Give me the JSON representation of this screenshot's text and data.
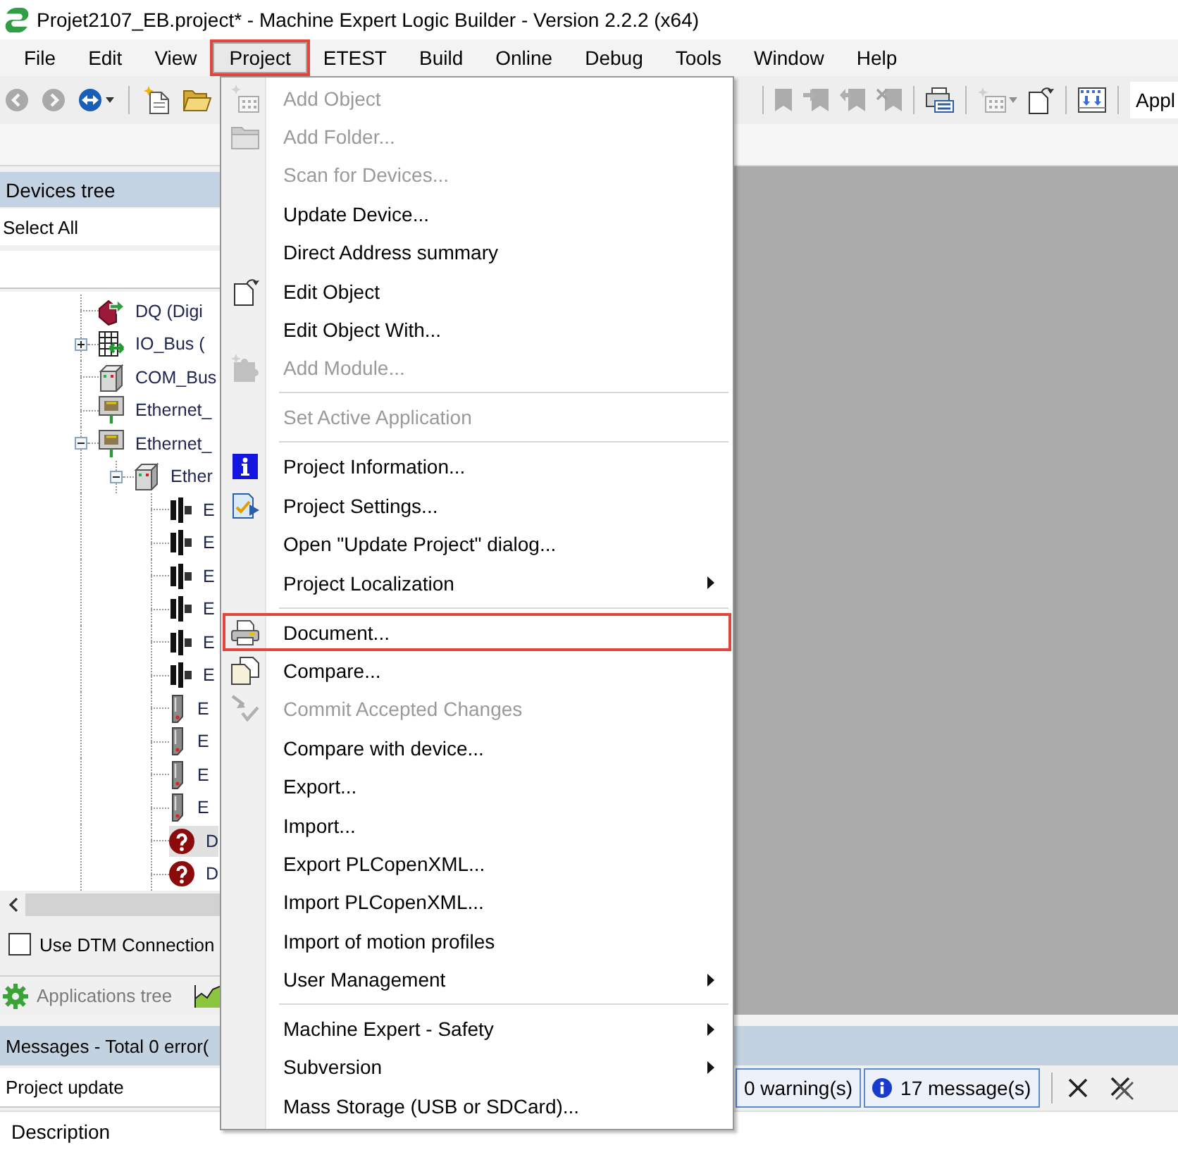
{
  "window": {
    "title": "Projet2107_EB.project* - Machine Expert Logic Builder - Version 2.2.2 (x64)"
  },
  "menu_bar": [
    {
      "label": "File",
      "selected": false
    },
    {
      "label": "Edit",
      "selected": false
    },
    {
      "label": "View",
      "selected": false
    },
    {
      "label": "Project",
      "selected": true
    },
    {
      "label": "ETEST",
      "selected": false
    },
    {
      "label": "Build",
      "selected": false
    },
    {
      "label": "Online",
      "selected": false
    },
    {
      "label": "Debug",
      "selected": false
    },
    {
      "label": "Tools",
      "selected": false
    },
    {
      "label": "Window",
      "selected": false
    },
    {
      "label": "Help",
      "selected": false
    }
  ],
  "toolbar": {
    "buttons": [
      {
        "disabled": true
      },
      {
        "disabled": true
      },
      {
        "disabled": false
      },
      {
        "disabled": false
      },
      {
        "disabled": false
      },
      {
        "disabled": true
      },
      {
        "disabled": true
      },
      {
        "disabled": true
      },
      {
        "disabled": true
      },
      {
        "disabled": false
      },
      {
        "disabled": true
      },
      {
        "disabled": false
      },
      {
        "disabled": false
      }
    ],
    "application": "Appl"
  },
  "project_menu": {
    "groups": [
      [
        {
          "label": "Add Object",
          "disabled": true,
          "submenu": false,
          "highlighted": false
        },
        {
          "label": "Add Folder...",
          "disabled": true,
          "submenu": false,
          "highlighted": false
        },
        {
          "label": "Scan for Devices...",
          "disabled": true,
          "submenu": false,
          "highlighted": false
        },
        {
          "label": "Update Device...",
          "disabled": false,
          "submenu": false,
          "highlighted": false
        },
        {
          "label": "Direct Address summary",
          "disabled": false,
          "submenu": false,
          "highlighted": false
        },
        {
          "label": "Edit Object",
          "disabled": false,
          "submenu": false,
          "highlighted": false
        },
        {
          "label": "Edit Object With...",
          "disabled": false,
          "submenu": false,
          "highlighted": false
        },
        {
          "label": "Add Module...",
          "disabled": true,
          "submenu": false,
          "highlighted": false
        }
      ],
      [
        {
          "label": "Set Active Application",
          "disabled": true,
          "submenu": false,
          "highlighted": false
        }
      ],
      [
        {
          "label": "Project Information...",
          "disabled": false,
          "submenu": false,
          "highlighted": false
        },
        {
          "label": "Project Settings...",
          "disabled": false,
          "submenu": false,
          "highlighted": false
        },
        {
          "label": "Open \"Update Project\" dialog...",
          "disabled": false,
          "submenu": false,
          "highlighted": false
        },
        {
          "label": "Project Localization",
          "disabled": false,
          "submenu": true,
          "highlighted": false
        }
      ],
      [
        {
          "label": "Document...",
          "disabled": false,
          "submenu": false,
          "highlighted": true
        },
        {
          "label": "Compare...",
          "disabled": false,
          "submenu": false,
          "highlighted": false
        },
        {
          "label": "Commit Accepted Changes",
          "disabled": true,
          "submenu": false,
          "highlighted": false
        },
        {
          "label": "Compare with device...",
          "disabled": false,
          "submenu": false,
          "highlighted": false
        },
        {
          "label": "Export...",
          "disabled": false,
          "submenu": false,
          "highlighted": false
        },
        {
          "label": "Import...",
          "disabled": false,
          "submenu": false,
          "highlighted": false
        },
        {
          "label": "Export PLCopenXML...",
          "disabled": false,
          "submenu": false,
          "highlighted": false
        },
        {
          "label": "Import PLCopenXML...",
          "disabled": false,
          "submenu": false,
          "highlighted": false
        },
        {
          "label": "Import of motion profiles",
          "disabled": false,
          "submenu": false,
          "highlighted": false
        },
        {
          "label": "User Management",
          "disabled": false,
          "submenu": true,
          "highlighted": false
        }
      ],
      [
        {
          "label": "Machine Expert - Safety",
          "disabled": false,
          "submenu": true,
          "highlighted": false
        },
        {
          "label": "Subversion",
          "disabled": false,
          "submenu": true,
          "highlighted": false
        },
        {
          "label": "Mass Storage (USB or SDCard)...",
          "disabled": false,
          "submenu": false,
          "highlighted": false
        }
      ]
    ]
  },
  "devices_panel": {
    "title": "Devices tree",
    "select_all": "Select All",
    "tree": [
      {
        "label": "DQ (Digi",
        "kind": "output",
        "selected": false
      },
      {
        "label": "IO_Bus (",
        "kind": "bus",
        "expanded": false,
        "selected": false
      },
      {
        "label": "COM_Bus",
        "kind": "coupler",
        "selected": false
      },
      {
        "label": "Ethernet_",
        "kind": "port",
        "selected": false
      },
      {
        "label": "Ethernet_",
        "kind": "port",
        "expanded": true,
        "selected": false,
        "children": [
          {
            "label": "Ether",
            "kind": "coupler",
            "expanded": true,
            "selected": false,
            "children": [
              {
                "label": "E",
                "kind": "connector",
                "selected": false
              },
              {
                "label": "E",
                "kind": "connector",
                "selected": false
              },
              {
                "label": "E",
                "kind": "connector",
                "selected": false
              },
              {
                "label": "E",
                "kind": "connector",
                "selected": false
              },
              {
                "label": "E",
                "kind": "connector",
                "selected": false
              },
              {
                "label": "E",
                "kind": "connector",
                "selected": false
              },
              {
                "label": "E",
                "kind": "drive",
                "selected": false
              },
              {
                "label": "E",
                "kind": "drive",
                "selected": false
              },
              {
                "label": "E",
                "kind": "drive",
                "selected": false
              },
              {
                "label": "E",
                "kind": "drive",
                "selected": false
              },
              {
                "label": "D",
                "kind": "unknown",
                "selected": true
              },
              {
                "label": "D",
                "kind": "unknown",
                "selected": false
              }
            ]
          }
        ]
      }
    ],
    "dtm_option": {
      "label": "Use DTM Connection",
      "checked": false
    }
  },
  "bottom_tabs": [
    {
      "label": "Applications tree",
      "selected": false
    }
  ],
  "messages": {
    "title": "Messages - Total 0 error(",
    "source": "Project update",
    "filters": [
      {
        "label": "0 warning(s)",
        "selected": true
      },
      {
        "label": "17 message(s)",
        "selected": true
      }
    ],
    "column": "Description"
  }
}
